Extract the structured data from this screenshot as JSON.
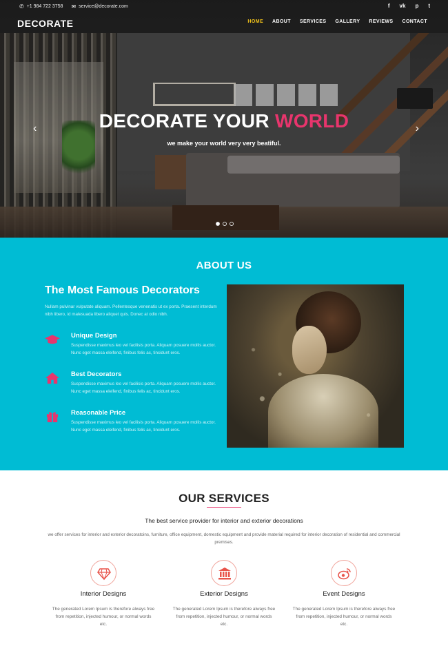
{
  "topbar": {
    "phone": "+1 984 722 3758",
    "email": "service@decorate.com",
    "phone_icon": "phone-icon",
    "email_icon": "envelope-icon",
    "social": [
      {
        "icon": "facebook-icon",
        "glyph": "f"
      },
      {
        "icon": "vk-icon",
        "glyph": "vk"
      },
      {
        "icon": "pinterest-icon",
        "glyph": "p"
      },
      {
        "icon": "twitter-icon",
        "glyph": "t"
      }
    ]
  },
  "nav": {
    "brand": "DECORATE",
    "items": [
      "HOME",
      "ABOUT",
      "SERVICES",
      "GALLERY",
      "REVIEWS",
      "CONTACT"
    ],
    "active": "HOME"
  },
  "hero": {
    "title_main": "DECORATE YOUR ",
    "title_accent": "WORLD",
    "subtitle": "we make your world very very beatiful.",
    "prev_glyph": "‹",
    "next_glyph": "›",
    "slides_total": 3,
    "slide_active": 1
  },
  "about": {
    "heading": "ABOUT US",
    "lead": "The Most Famous Decorators",
    "intro": "Nullam pulvinar vulputate aliquam. Pellentesque venenatis ut ex porta. Praesent interdum nibh libero, id malesuada libero aliquet quis. Donec at odio nibh.",
    "features": [
      {
        "icon": "graduation-cap-icon",
        "title": "Unique Design",
        "text": "Suspendisse maximus leo vel facilisis porta. Aliquam posuere mollis auctor. Nunc eget massa eleifend, finibus felis ac, tincidunt eros."
      },
      {
        "icon": "home-icon",
        "title": "Best Decorators",
        "text": "Suspendisse maximus leo vel facilisis porta. Aliquam posuere mollis auctor. Nunc eget massa eleifend, finibus felis ac, tincidunt eros."
      },
      {
        "icon": "gift-icon",
        "title": "Reasonable Price",
        "text": "Suspendisse maximus leo vel facilisis porta. Aliquam posuere mollis auctor. Nunc eget massa eleifend, finibus felis ac, tincidunt eros."
      }
    ]
  },
  "services": {
    "heading": "OUR SERVICES",
    "tagline": "The best service provider for interior and exterior decorations",
    "description": "we offer services for interior and exterior decoratoins, furniture, office equipment, domestic equipment and provide material required for interior decoration of residential and commercial premises.",
    "items": [
      {
        "icon": "diamond-icon",
        "title": "Interior Designs",
        "text": "The generated Lorem Ipsum is therefore always free from repetition, injected humour, or normal words etc."
      },
      {
        "icon": "bank-icon",
        "title": "Exterior Designs",
        "text": "The generated Lorem Ipsum is therefore always free from repetition, injected humour, or normal words etc."
      },
      {
        "icon": "weibo-icon",
        "title": "Event Designs",
        "text": "The generated Lorem Ipsum is therefore always free from repetition, injected humour, or normal words etc."
      }
    ]
  },
  "colors": {
    "accent_pink": "#e8356d",
    "about_bg": "#00bcd4",
    "nav_active": "#f2c31a",
    "service_icon": "#e8534a"
  }
}
